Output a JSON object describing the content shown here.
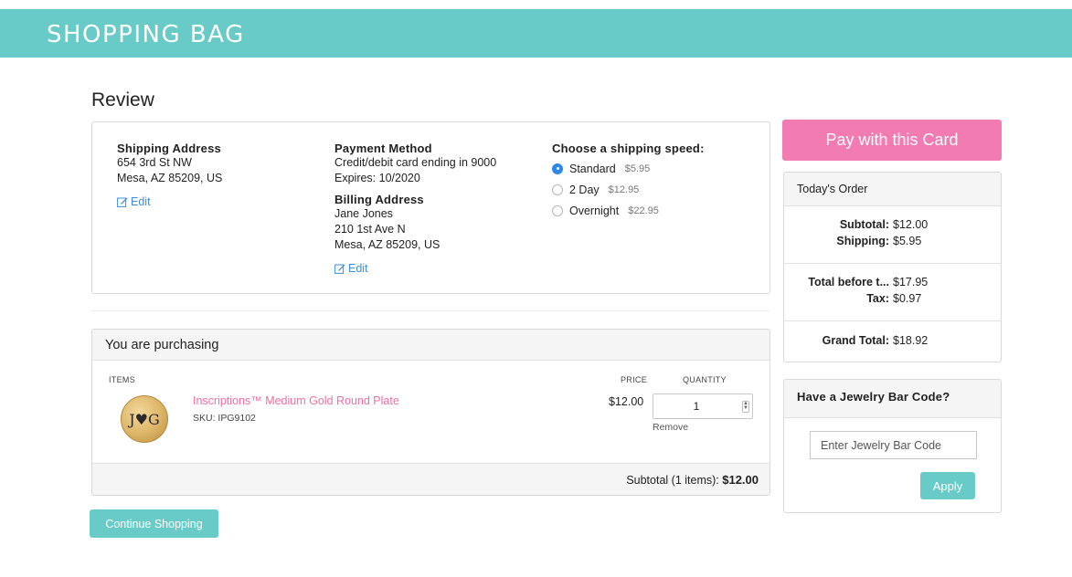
{
  "header": {
    "title": "SHOPPING BAG"
  },
  "review": {
    "title": "Review",
    "shipping_address": {
      "heading": "Shipping Address",
      "line1": "654 3rd St NW",
      "line2": "Mesa, AZ 85209, US",
      "edit_label": "Edit"
    },
    "payment": {
      "heading": "Payment Method",
      "line1": "Credit/debit card ending in 9000",
      "line2": "Expires: 10/2020"
    },
    "billing_address": {
      "heading": "Billing Address",
      "line1": "Jane Jones",
      "line2": "210 1st Ave N",
      "line3": "Mesa, AZ 85209, US",
      "edit_label": "Edit"
    },
    "shipping_speed": {
      "heading": "Choose a shipping speed:",
      "options": [
        {
          "label": "Standard",
          "price": "$5.95",
          "selected": true
        },
        {
          "label": "2 Day",
          "price": "$12.95",
          "selected": false
        },
        {
          "label": "Overnight",
          "price": "$22.95",
          "selected": false
        }
      ]
    }
  },
  "purchase": {
    "heading": "You are purchasing",
    "columns": {
      "items": "ITEMS",
      "price": "PRICE",
      "quantity": "QUANTITY"
    },
    "items": [
      {
        "name": "Inscriptions™ Medium Gold Round Plate",
        "sku": "SKU: IPG9102",
        "engraving": "J♥G",
        "price": "$12.00",
        "quantity": "1",
        "remove_label": "Remove"
      }
    ],
    "subtotal_label": "Subtotal (1 items):",
    "subtotal_value": "$12.00"
  },
  "continue_label": "Continue Shopping",
  "pay_label": "Pay with this Card",
  "order": {
    "heading": "Today's Order",
    "subtotal_label": "Subtotal:",
    "subtotal_value": "$12.00",
    "shipping_label": "Shipping:",
    "shipping_value": "$5.95",
    "before_tax_label": "Total before t...",
    "before_tax_value": "$17.95",
    "tax_label": "Tax:",
    "tax_value": "$0.97",
    "grand_label": "Grand Total:",
    "grand_value": "$18.92"
  },
  "bar_code": {
    "heading": "Have a Jewelry Bar Code?",
    "placeholder": "Enter Jewelry Bar Code",
    "apply_label": "Apply"
  },
  "colors": {
    "teal": "#68cbc7",
    "pink": "#f27bb2",
    "link_blue": "#3d8fd6",
    "product_link": "#ef6fa9"
  }
}
